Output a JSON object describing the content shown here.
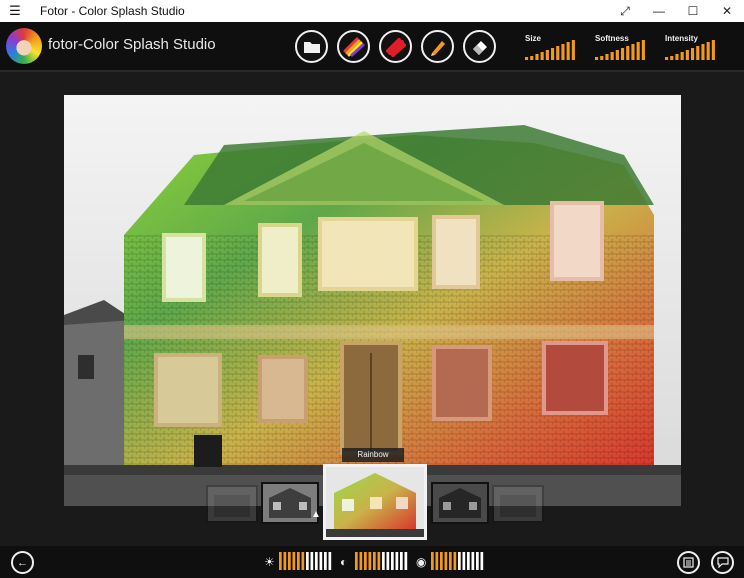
{
  "window": {
    "title": "Fotor - Color Splash Studio",
    "menu_icon": "☰",
    "minimize_glyph": "—",
    "maximize_glyph": "☐",
    "close_glyph": "✕",
    "fullscreen_glyph": "⤢"
  },
  "toolbar": {
    "app_title": "fotor-Color Splash Studio",
    "tools": [
      {
        "name": "open-folder",
        "icon": "folder-icon"
      },
      {
        "name": "rainbow-brush",
        "icon": "rainbow-brush-icon"
      },
      {
        "name": "red-brush",
        "icon": "red-brush-icon"
      },
      {
        "name": "pencil",
        "icon": "pencil-icon"
      },
      {
        "name": "eraser",
        "icon": "eraser-icon"
      }
    ],
    "sliders": [
      {
        "label": "Size",
        "level": 1.0
      },
      {
        "label": "Softness",
        "level": 1.0
      },
      {
        "label": "Intensity",
        "level": 1.0
      }
    ]
  },
  "filters": {
    "selected_label": "Rainbow",
    "thumbnails": [
      "faded",
      "grayscale",
      "rainbow",
      "dark",
      "faded"
    ]
  },
  "bottom": {
    "adjustments": [
      {
        "name": "brightness",
        "icon": "sun-icon",
        "glyph": "☀",
        "level": 0.5
      },
      {
        "name": "contrast",
        "icon": "contrast-icon",
        "glyph": "◐",
        "level": 0.5
      },
      {
        "name": "saturation",
        "icon": "saturation-icon",
        "glyph": "◉",
        "level": 0.5
      }
    ]
  },
  "colors": {
    "accent": "#f29a1e",
    "toolbar_bg": "#0f0f0f",
    "workspace_bg": "#1a1a1a",
    "eraser_bg": "#ffffff"
  }
}
